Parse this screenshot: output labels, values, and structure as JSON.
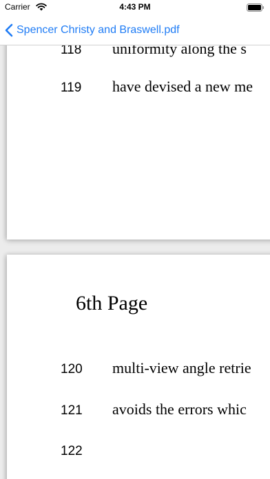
{
  "status_bar": {
    "carrier": "Carrier",
    "time": "4:43 PM"
  },
  "nav": {
    "back_title": "Spencer Christy and Braswell.pdf",
    "accent_color": "#1f7cf5"
  },
  "pages": {
    "previous": {
      "lines": [
        {
          "number": "118",
          "text": "uniformity along the s"
        },
        {
          "number": "119",
          "text": "have devised a new me"
        }
      ]
    },
    "current": {
      "heading": "6th Page",
      "lines": [
        {
          "number": "120",
          "text": "multi-view angle retrie"
        },
        {
          "number": "121",
          "text": "avoids the errors whic"
        },
        {
          "number": "122",
          "text": ""
        }
      ]
    }
  }
}
